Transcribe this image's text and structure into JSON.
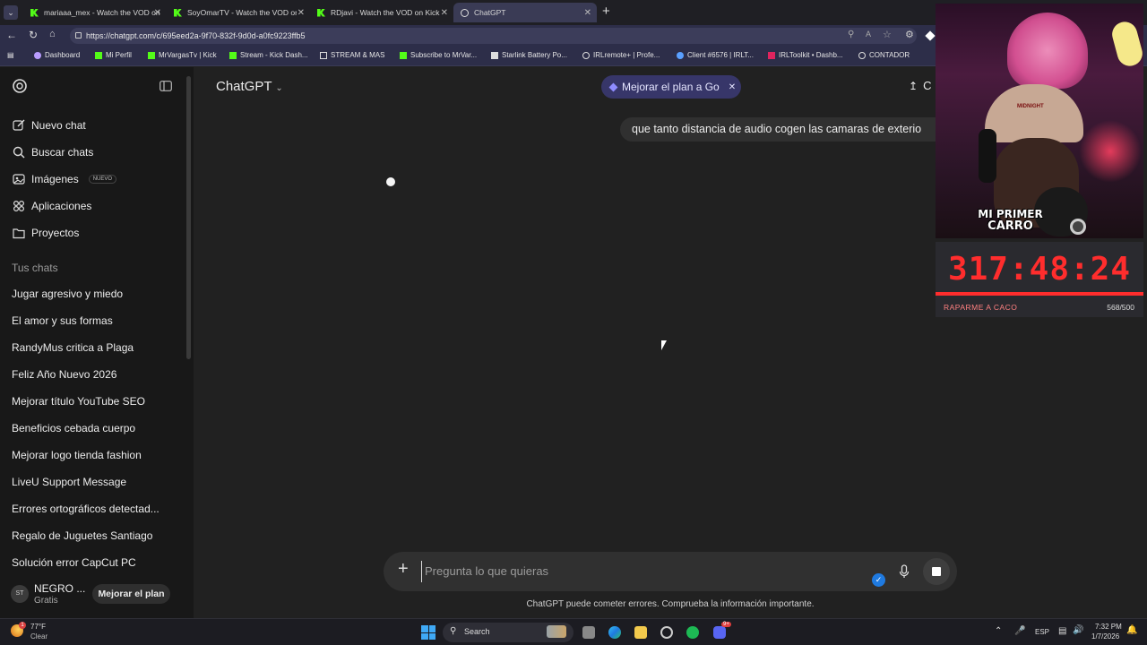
{
  "browser": {
    "tabs": [
      {
        "title": "mariaaa_mex - Watch the VOD on"
      },
      {
        "title": "SoyOmarTV - Watch the VOD on K"
      },
      {
        "title": "RDjavi - Watch the VOD on Kick"
      },
      {
        "title": "ChatGPT"
      }
    ],
    "url": "https://chatgpt.com/c/695eed2a-9f70-832f-9d0d-a0fc9223ffb5",
    "bookmarks": [
      "Dashboard",
      "Mi Perfil",
      "MrVargasTv | Kick",
      "Stream - Kick Dash...",
      "STREAM & MAS",
      "Subscribe to MrVar...",
      "Starlink Battery Po...",
      "IRLremote+ | Profe...",
      "Client #6576 | IRLT...",
      "IRLToolkit • Dashb...",
      "CONTADOR"
    ]
  },
  "sidebar": {
    "nav": [
      {
        "label": "Nuevo chat",
        "icon": "edit-icon"
      },
      {
        "label": "Buscar chats",
        "icon": "search-icon"
      },
      {
        "label": "Imágenes",
        "icon": "image-icon",
        "badge": "NUEVO"
      },
      {
        "label": "Aplicaciones",
        "icon": "apps-icon"
      },
      {
        "label": "Proyectos",
        "icon": "folder-icon"
      }
    ],
    "section_title": "Tus chats",
    "chats": [
      "Jugar agresivo y miedo",
      "El amor y sus formas",
      "RandyMus critica a Plaga",
      "Feliz Año Nuevo 2026",
      "Mejorar título YouTube SEO",
      "Beneficios cebada cuerpo",
      "Mejorar logo tienda fashion",
      "LiveU Support Message",
      "Errores ortográficos detectad...",
      "Regalo de Juguetes Santiago",
      "Solución error CapCut PC"
    ],
    "user": {
      "initials": "ST",
      "name": "NEGRO ...",
      "plan": "Gratis",
      "upgrade_label": "Mejorar el plan"
    }
  },
  "main": {
    "model_label": "ChatGPT",
    "upgrade_pill": "Mejorar el plan a Go",
    "share_label": "C",
    "user_message": "que tanto distancia de audio cogen las camaras de exterio",
    "composer_placeholder": "Pregunta lo que quieras",
    "disclaimer": "ChatGPT puede cometer errores. Comprueba la información importante."
  },
  "overlay": {
    "cap_text": "MIDNIGHT",
    "banner_line1": "MI PRIMER",
    "banner_line2": "CARRO",
    "timer": "317:48:24",
    "goal_label": "RAPARME A CACO",
    "goal_count": "568/500",
    "goal_progress": 1.0
  },
  "taskbar": {
    "weather_temp": "77°F",
    "weather_desc": "Clear",
    "weather_badge": "1",
    "search_label": "Search",
    "language": "ESP",
    "time": "7:32 PM",
    "date": "1/7/2026",
    "discord_badge": "9+"
  },
  "colors": {
    "kick_green": "#53fc18",
    "timer_red": "#ff2d2d",
    "accent_blue": "#1f7ae0"
  }
}
